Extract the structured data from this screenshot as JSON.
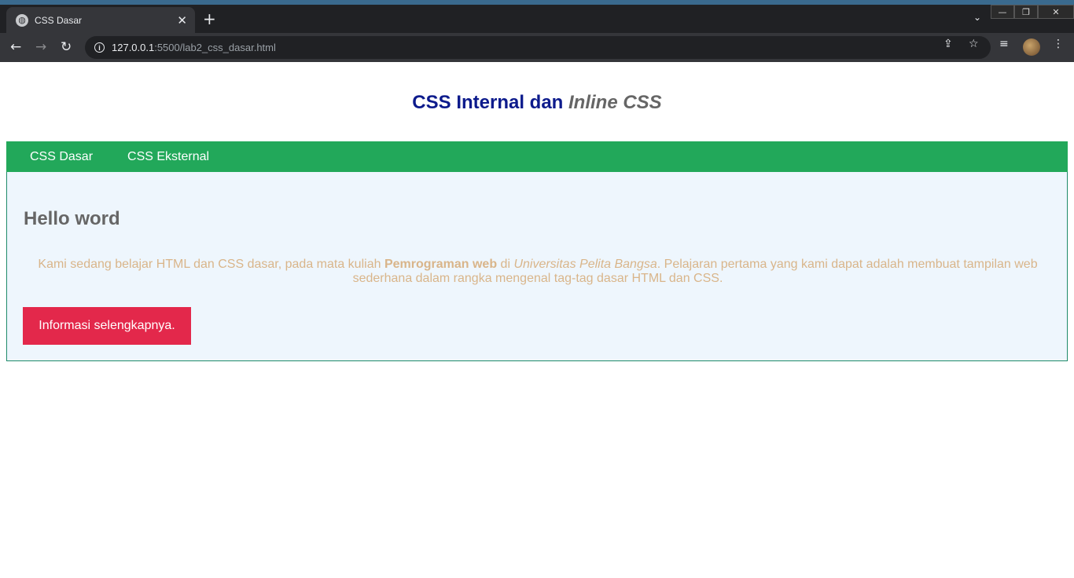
{
  "browser": {
    "tab": {
      "title": "CSS Dasar",
      "close": "✕"
    },
    "new_tab": "+",
    "tab_search": "⌄",
    "window": {
      "minimize": "—",
      "restore": "❐",
      "close": "✕"
    },
    "nav": {
      "back": "←",
      "forward": "→",
      "reload": "↻"
    },
    "url": {
      "host": "127.0.0.1",
      "rest": ":5500/lab2_css_dasar.html"
    },
    "omnibox_icons": {
      "share": "⇪",
      "bookmark": "☆",
      "reading_list": "≡",
      "menu": "⋮"
    }
  },
  "page": {
    "title_main": "CSS Internal dan ",
    "title_italic": "Inline CSS",
    "nav_links": [
      "CSS Dasar",
      "CSS Eksternal"
    ],
    "heading": "Hello word",
    "paragraph": {
      "part1": "Kami sedang belajar HTML dan CSS dasar, pada mata kuliah ",
      "bold": "Pemrograman web",
      "part2": " di ",
      "italic": "Universitas Pelita Bangsa",
      "part3": ". Pelajaran pertama yang kami dapat adalah membuat tampilan web sederhana dalam rangka mengenal tag-tag dasar HTML dan CSS."
    },
    "button_label": "Informasi selengkapnya."
  },
  "colors": {
    "navbar": "#22a85a",
    "title": "#0d1b8c",
    "button": "#e3284b",
    "paragraph": "#d9b58a",
    "content_bg": "#eef6fd"
  }
}
